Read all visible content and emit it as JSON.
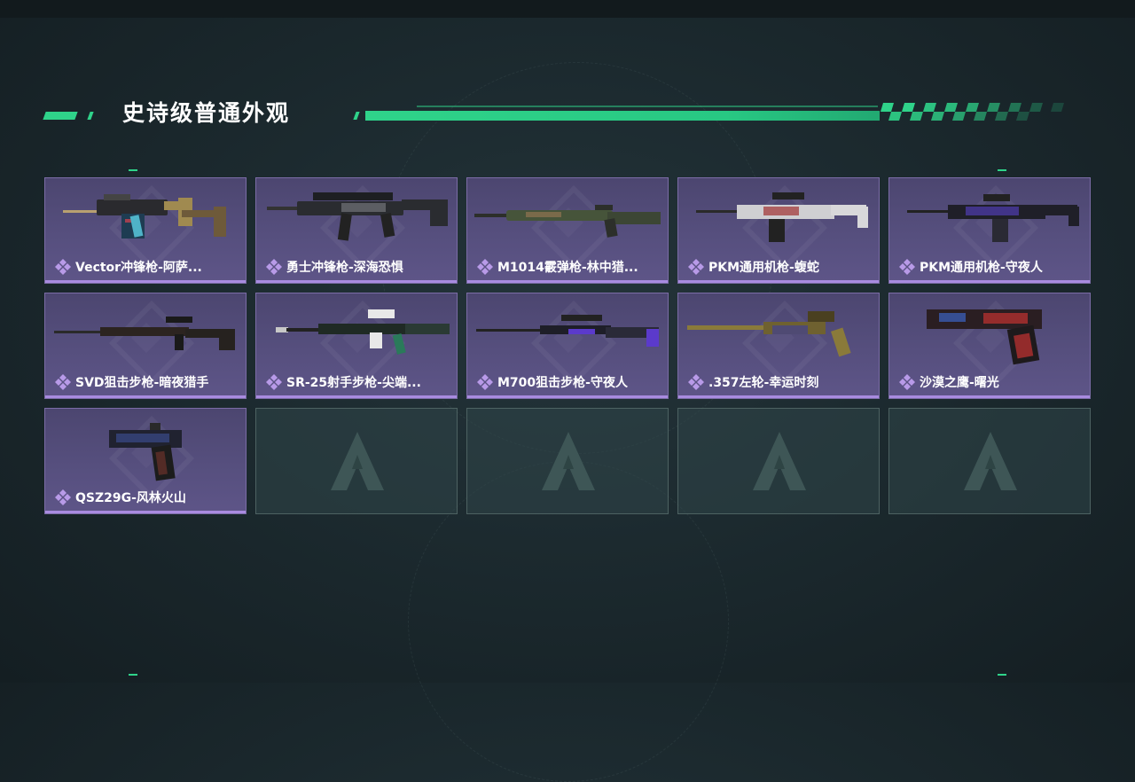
{
  "section": {
    "title": "史诗级普通外观",
    "accent_color": "#2fd38a",
    "card_color": "#564f7e",
    "rarity_color": "#a98be0"
  },
  "items": [
    {
      "name": "Vector冲锋枪-阿萨...",
      "weapon": "smg-vector",
      "icon": "gem-icon"
    },
    {
      "name": "勇士冲锋枪-深海恐惧",
      "weapon": "smg-warrior",
      "icon": "gem-icon"
    },
    {
      "name": "M1014霰弹枪-林中猎...",
      "weapon": "shotgun-m1014",
      "icon": "gem-icon"
    },
    {
      "name": "PKM通用机枪-蝮蛇",
      "weapon": "mg-pkm-viper",
      "icon": "gem-icon"
    },
    {
      "name": "PKM通用机枪-守夜人",
      "weapon": "mg-pkm-watch",
      "icon": "gem-icon"
    },
    {
      "name": "SVD狙击步枪-暗夜猎手",
      "weapon": "sniper-svd",
      "icon": "gem-icon"
    },
    {
      "name": "SR-25射手步枪-尖端...",
      "weapon": "dmr-sr25",
      "icon": "gem-icon"
    },
    {
      "name": "M700狙击步枪-守夜人",
      "weapon": "sniper-m700",
      "icon": "gem-icon"
    },
    {
      "name": ".357左轮-幸运时刻",
      "weapon": "revolver-357",
      "icon": "gem-icon"
    },
    {
      "name": "沙漠之鹰-曙光",
      "weapon": "pistol-deagle",
      "icon": "gem-icon"
    },
    {
      "name": "QSZ29G-风林火山",
      "weapon": "pistol-qsz29g",
      "icon": "gem-icon"
    }
  ],
  "empty_slots": 4
}
